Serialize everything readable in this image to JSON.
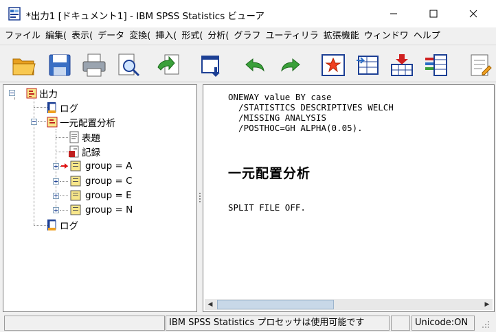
{
  "window": {
    "title": "*出力1 [ドキュメント1] - IBM SPSS Statistics ビューア"
  },
  "menu": {
    "items": [
      "ファイル",
      "編集(",
      "表示(",
      "データ",
      "変換(",
      "挿入(",
      "形式(",
      "分析(",
      "グラフ",
      "ユーティリラ",
      "拡張機能",
      "ウィンドワ",
      "ヘルプ"
    ]
  },
  "toolbar": {
    "buttons": [
      "open-folder-icon",
      "save-icon",
      "print-icon",
      "print-preview-icon",
      "export-icon",
      "goto-data-icon",
      "undo-icon",
      "redo-icon",
      "designate-window-icon",
      "goto-case-icon",
      "insert-variable-icon",
      "variables-icon",
      "new-syntax-icon"
    ]
  },
  "tree": {
    "root": "出力",
    "log1": "ログ",
    "oneway": "一元配置分析",
    "title": "表題",
    "notes": "記録",
    "group_a": "group = A",
    "group_c": "group = C",
    "group_e": "group = E",
    "group_n": "group = N",
    "log2": "ログ"
  },
  "content": {
    "syntax": "ONEWAY value BY case\n  /STATISTICS DESCRIPTIVES WELCH\n  /MISSING ANALYSIS\n  /POSTHOC=GH ALPHA(0.05).",
    "heading": "一元配置分析",
    "syntax2": "SPLIT FILE OFF."
  },
  "status": {
    "processor": "IBM SPSS Statistics プロセッサは使用可能です",
    "unicode": "Unicode:ON"
  },
  "colors": {
    "accent": "#1c3f94",
    "titlebar_bg": "#ffffff",
    "chrome_bg": "#f0f0f0"
  }
}
